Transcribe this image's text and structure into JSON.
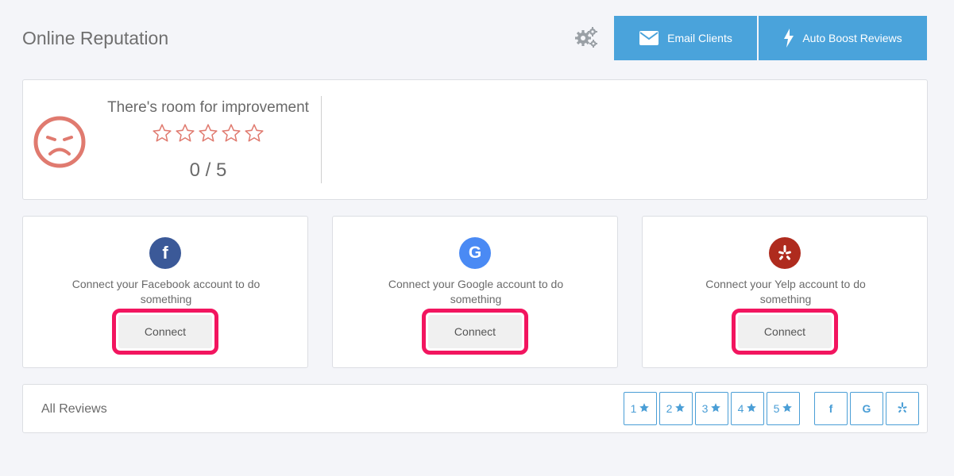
{
  "page": {
    "title": "Online Reputation"
  },
  "header": {
    "settings_icon": "gears-icon",
    "email_clients_label": "Email Clients",
    "auto_boost_label": "Auto Boost Reviews"
  },
  "summary": {
    "message": "There's room for improvement",
    "rating": 0,
    "max_rating": 5,
    "score_text": "0 / 5",
    "mood_icon": "sad-face-icon",
    "accent_color": "#e07a6f"
  },
  "services": [
    {
      "name": "Facebook",
      "description": "Connect your Facebook account to do something",
      "button_label": "Connect",
      "color": "#3b5998",
      "glyph": "f"
    },
    {
      "name": "Google",
      "description": "Connect your Google account to do something",
      "button_label": "Connect",
      "color": "#4a8af4",
      "glyph": "G"
    },
    {
      "name": "Yelp",
      "description": "Connect your Yelp account to do something",
      "button_label": "Connect",
      "color": "#af2b1e",
      "glyph": "yelp"
    }
  ],
  "reviews": {
    "label": "All Reviews",
    "star_filters": [
      "1",
      "2",
      "3",
      "4",
      "5"
    ],
    "source_filters": [
      "f",
      "G",
      "yelp"
    ]
  },
  "colors": {
    "primary": "#4aa3db",
    "highlight": "#f2155f"
  }
}
